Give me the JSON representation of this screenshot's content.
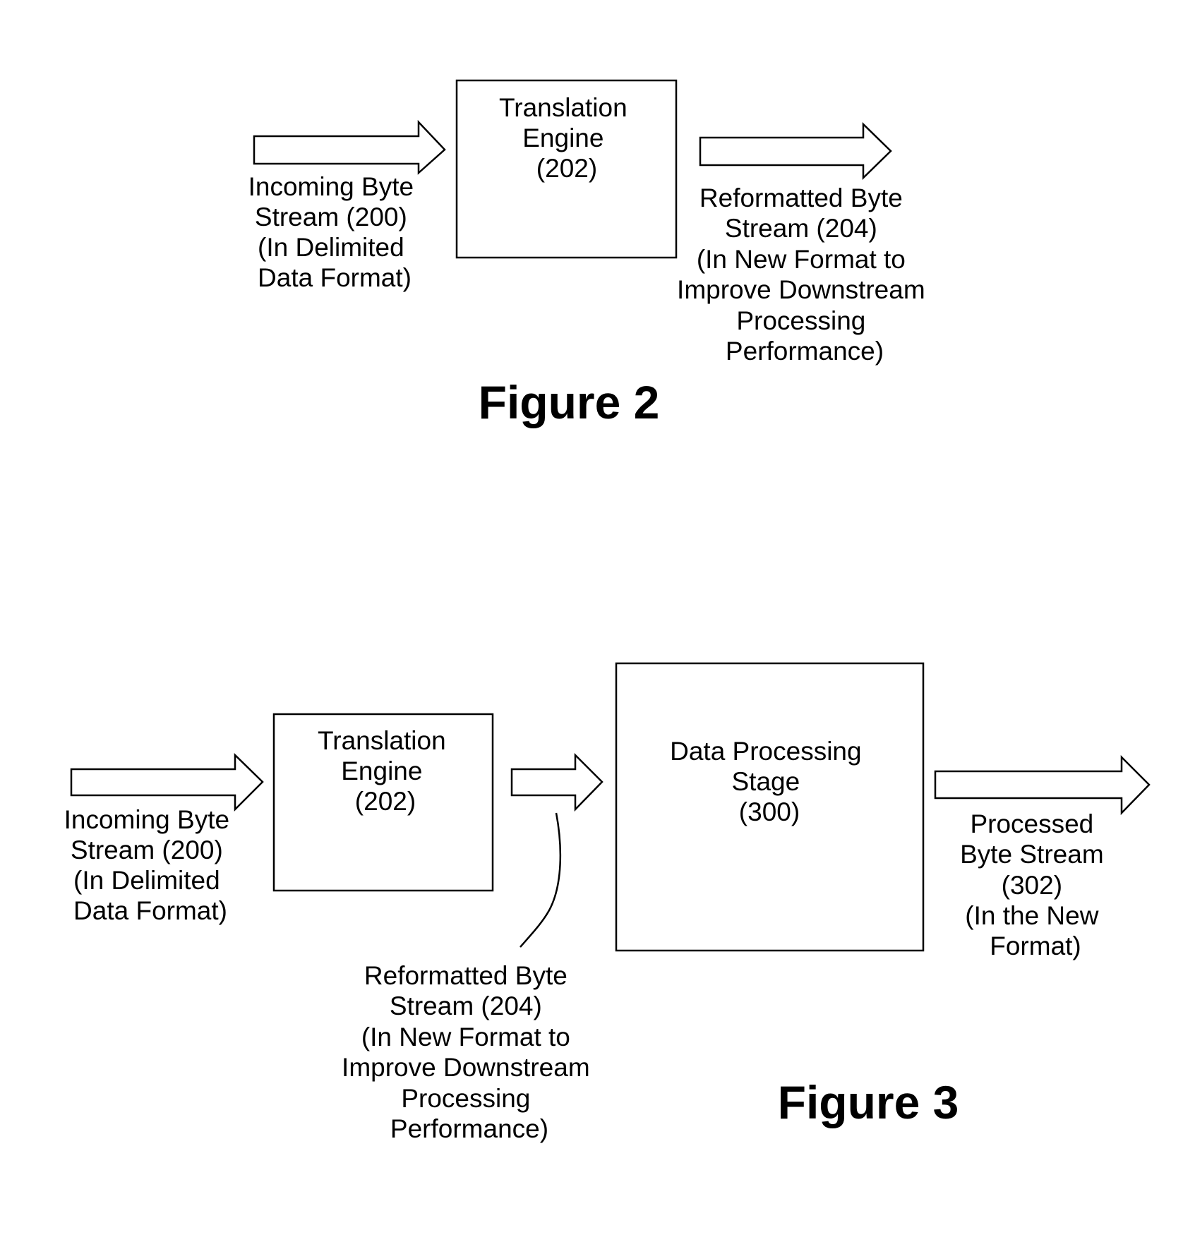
{
  "figure2": {
    "caption": "Figure 2",
    "translation_engine": [
      "Translation",
      "Engine",
      "(202)"
    ],
    "input_label": [
      "Incoming Byte",
      "Stream (200)",
      "(In Delimited",
      "Data Format)"
    ],
    "output_label": [
      "Reformatted Byte",
      "Stream (204)",
      "(In New Format to",
      "Improve Downstream",
      "Processing",
      "Performance)"
    ]
  },
  "figure3": {
    "caption": "Figure 3",
    "translation_engine": [
      "Translation",
      "Engine",
      "(202)"
    ],
    "data_processing_stage": [
      "Data Processing",
      "Stage",
      "(300)"
    ],
    "input_label": [
      "Incoming Byte",
      "Stream (200)",
      "(In Delimited",
      "Data Format)"
    ],
    "reformatted_label": [
      "Reformatted Byte",
      "Stream (204)",
      "(In New Format to",
      "Improve Downstream",
      "Processing",
      "Performance)"
    ],
    "output_label": [
      "Processed",
      "Byte Stream",
      "(302)",
      "(In the New",
      "Format)"
    ]
  },
  "colors": {
    "ink": "#000000",
    "paper": "#ffffff"
  }
}
